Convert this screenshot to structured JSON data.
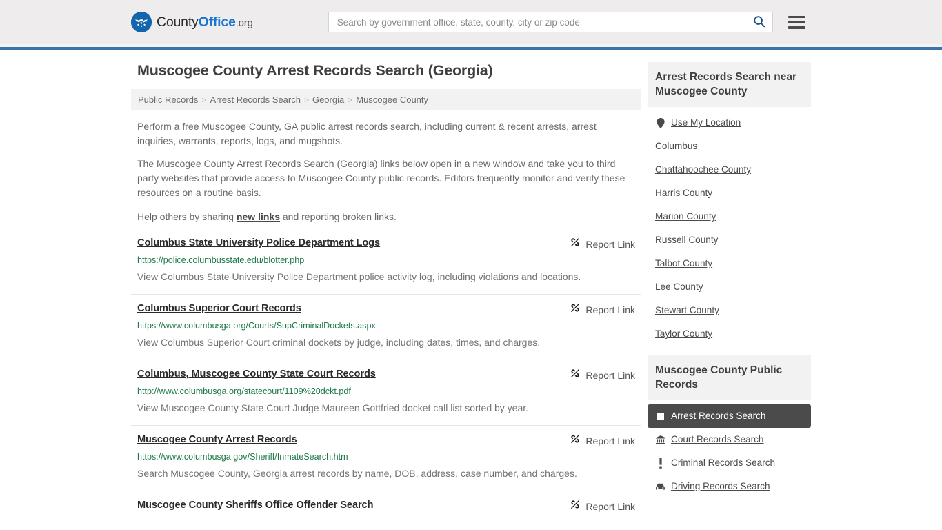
{
  "header": {
    "logo": {
      "icon": "eagle-shield-logo",
      "text_part1": "County",
      "text_part2": "Office",
      "text_part3": ".org"
    },
    "search": {
      "placeholder": "Search by government office, state, county, city or zip code",
      "value": "",
      "icon": "search-icon"
    },
    "menu_icon": "hamburger-menu-icon",
    "accent_color": "#3d74a8"
  },
  "page": {
    "title": "Muscogee County Arrest Records Search (Georgia)"
  },
  "breadcrumb": {
    "items": [
      {
        "label": "Public Records"
      },
      {
        "label": "Arrest Records Search"
      },
      {
        "label": "Georgia"
      },
      {
        "label": "Muscogee County"
      }
    ],
    "separator": ">"
  },
  "intro": {
    "paragraph1": "Perform a free Muscogee County, GA public arrest records search, including current & recent arrests, arrest inquiries, warrants, reports, logs, and mugshots.",
    "paragraph2": "The Muscogee County Arrest Records Search (Georgia) links below open in a new window and take you to third party websites that provide access to Muscogee County public records. Editors frequently monitor and verify these resources on a routine basis.",
    "paragraph3_before": "Help others by sharing ",
    "paragraph3_link": "new links",
    "paragraph3_after": " and reporting broken links."
  },
  "report_link": {
    "label": "Report Link",
    "icon": "broken-link-icon"
  },
  "results": [
    {
      "title": "Columbus State University Police Department Logs",
      "url": "https://police.columbusstate.edu/blotter.php",
      "description": "View Columbus State University Police Department police activity log, including violations and locations."
    },
    {
      "title": "Columbus Superior Court Records",
      "url": "https://www.columbusga.org/Courts/SupCriminalDockets.aspx",
      "description": "View Columbus Superior Court criminal dockets by judge, including dates, times, and charges."
    },
    {
      "title": "Columbus, Muscogee County State Court Records",
      "url": "http://www.columbusga.org/statecourt/1109%20dckt.pdf",
      "description": "View Muscogee County State Court Judge Maureen Gottfried docket call list sorted by year."
    },
    {
      "title": "Muscogee County Arrest Records",
      "url": "https://www.columbusga.gov/Sheriff/InmateSearch.htm",
      "description": "Search Muscogee County, Georgia arrest records by name, DOB, address, case number, and charges."
    },
    {
      "title": "Muscogee County Sheriffs Office Offender Search",
      "url": "",
      "description": ""
    }
  ],
  "sidebar": {
    "nearby": {
      "heading": "Arrest Records Search near Muscogee County",
      "items": [
        {
          "label": "Use My Location",
          "icon": "map-pin-icon"
        },
        {
          "label": "Columbus",
          "icon": ""
        },
        {
          "label": "Chattahoochee County",
          "icon": ""
        },
        {
          "label": "Harris County",
          "icon": ""
        },
        {
          "label": "Marion County",
          "icon": ""
        },
        {
          "label": "Russell County",
          "icon": ""
        },
        {
          "label": "Talbot County",
          "icon": ""
        },
        {
          "label": "Lee County",
          "icon": ""
        },
        {
          "label": "Stewart County",
          "icon": ""
        },
        {
          "label": "Taylor County",
          "icon": ""
        }
      ]
    },
    "public_records": {
      "heading": "Muscogee County Public Records",
      "active_index": 0,
      "items": [
        {
          "label": "Arrest Records Search",
          "icon": "white-square-icon"
        },
        {
          "label": "Court Records Search",
          "icon": "courthouse-icon"
        },
        {
          "label": "Criminal Records Search",
          "icon": "exclamation-icon"
        },
        {
          "label": "Driving Records Search",
          "icon": "car-icon"
        }
      ]
    }
  }
}
